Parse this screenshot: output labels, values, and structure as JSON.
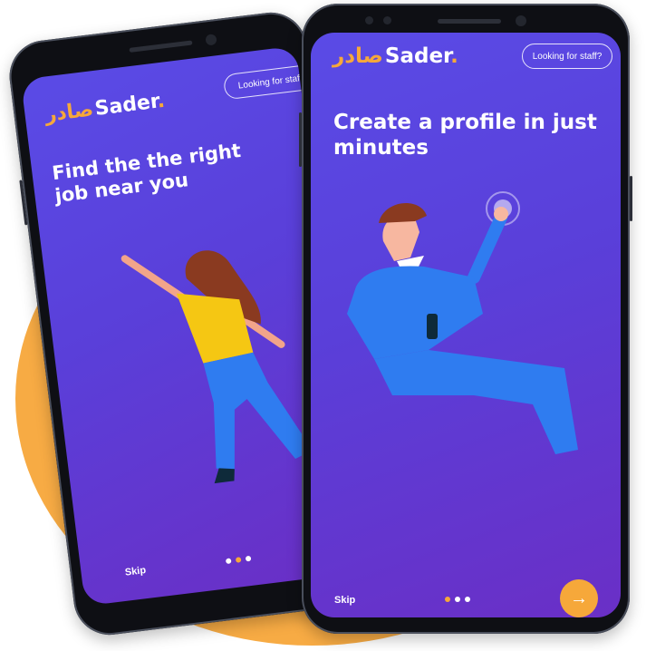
{
  "brand": {
    "latin": "Sader",
    "arabic": "صادر",
    "dot": "."
  },
  "back_screen": {
    "staff_link": "Looking for staff",
    "headline": "Find the the right job near you",
    "skip": "Skip",
    "page_dots": 3,
    "active_dot": 2
  },
  "front_screen": {
    "staff_link": "Looking for staff?",
    "headline": "Create a profile in just minutes",
    "skip": "Skip",
    "page_dots": 3,
    "active_dot": 1,
    "next_icon": "arrow-right-icon",
    "next_symbol": "→"
  },
  "colors": {
    "background_circle": "#f7ab44",
    "screen_gradient_start": "#5a4be6",
    "screen_gradient_end": "#6a2fc6",
    "accent": "#f6a83a",
    "figure_blue": "#2f7cf0",
    "figure_yellow": "#f5c713"
  }
}
